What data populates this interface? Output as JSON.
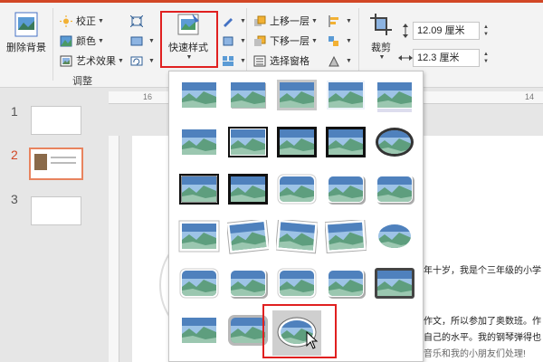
{
  "ribbon": {
    "remove_bg_label": "删除背景",
    "adjust": {
      "correct_label": "校正",
      "color_label": "颜色",
      "artistic_label": "艺术效果",
      "group_label": "调整"
    },
    "quick_styles_label": "快速样式",
    "arrange": {
      "bring_forward_label": "上移一层",
      "send_backward_label": "下移一层",
      "selection_pane_label": "选择窗格"
    },
    "crop_label": "裁剪",
    "size": {
      "height_value": "12.09 厘米",
      "width_value": "12.3 厘米"
    }
  },
  "thumbnails": [
    {
      "number": "1"
    },
    {
      "number": "2"
    },
    {
      "number": "3"
    }
  ],
  "ruler": {
    "top_label_left": "16",
    "top_label_right": "14"
  },
  "doc": {
    "line1": "年十岁，我是个三年级的小学",
    "line2": "作文，所以参加了奥数班。作",
    "line3": "自己的水平。我的钢琴弹得也",
    "line4": "音乐和我的小朋友们处理!"
  },
  "gallery": {
    "rows": 6,
    "cols": 5,
    "selected_row": 5,
    "selected_col": 2
  },
  "colors": {
    "accent": "#d24726",
    "highlight": "#e02020"
  }
}
